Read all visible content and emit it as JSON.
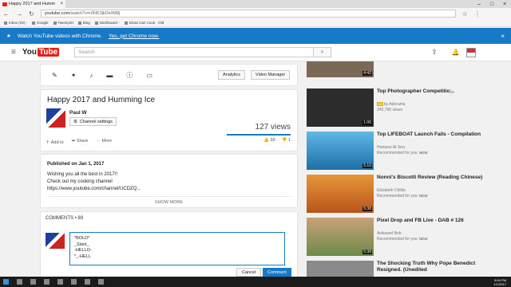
{
  "browser": {
    "tab_title": "Happy 2017 and Humm",
    "url_host": "youtube.com",
    "url_rest": "/watch?v=r0NK3jkDk4M8j",
    "bookmarks": [
      "Inbox (23) -",
      "Google",
      "Twenty20",
      "Bing",
      "Dashboard -",
      "Divas Can Cook · Old"
    ]
  },
  "banner": {
    "text": "Watch YouTube videos with Chrome.",
    "link": "Yes, get Chrome now."
  },
  "header": {
    "logo_you": "You",
    "logo_tube": "Tube",
    "search_placeholder": "Search"
  },
  "toolbar": {
    "analytics": "Analytics",
    "video_manager": "Video Manager"
  },
  "video": {
    "title": "Happy 2017 and Humming Ice",
    "channel": "Paul W",
    "channel_settings": "Channel settings",
    "views": "127 views",
    "add_to": "Add to",
    "share": "Share",
    "more": "More",
    "likes": "38",
    "dislikes": "1"
  },
  "description": {
    "published": "Published on Jan 1, 2017",
    "line1": "Wishing you all the best in 2017!!",
    "line2": "Check out my cooking channel",
    "line3": "https://www.youtube.com/channel/UCDZQ...",
    "show_more": "SHOW MORE"
  },
  "comments": {
    "header": "COMMENTS • 89",
    "draft": "*BOLD*\n_Slant_\n-HELLO-\n*_-HELL",
    "cancel": "Cancel",
    "comment": "Comment"
  },
  "sidebar": [
    {
      "title": "",
      "channel": "",
      "meta": "",
      "duration": "4:42",
      "badge": ""
    },
    {
      "title": "Top Photographer Competitio...",
      "channel": "by Adorama",
      "meta": "240,766 views",
      "duration": "1:06",
      "badge": "Ad"
    },
    {
      "title": "Top LIFEBOAT Launch Fails - Compilation",
      "channel": "Humans At Sea",
      "meta": "Recommended for you",
      "duration": "5:10",
      "badge": "NEW"
    },
    {
      "title": "Nonni's Biscotti Review (Reading Chinese)",
      "channel": "Elizabeth Childs",
      "meta": "Recommended for you",
      "duration": "5:38",
      "badge": "NEW"
    },
    {
      "title": "Pixel Drop and FB Live - DAB # 126",
      "channel": "Awkward Bob",
      "meta": "Recommended for you",
      "duration": "5:38",
      "badge": "NEW"
    },
    {
      "title": "The Shocking Truth Why Pope Benedict Resigned. (Unedited",
      "channel": "",
      "meta": "",
      "duration": "",
      "badge": ""
    }
  ],
  "taskbar": {
    "time": "5:54 PM",
    "date": "1/1/2017"
  },
  "colors": {
    "brand_red": "#e62117",
    "accent_blue": "#167ac6"
  }
}
